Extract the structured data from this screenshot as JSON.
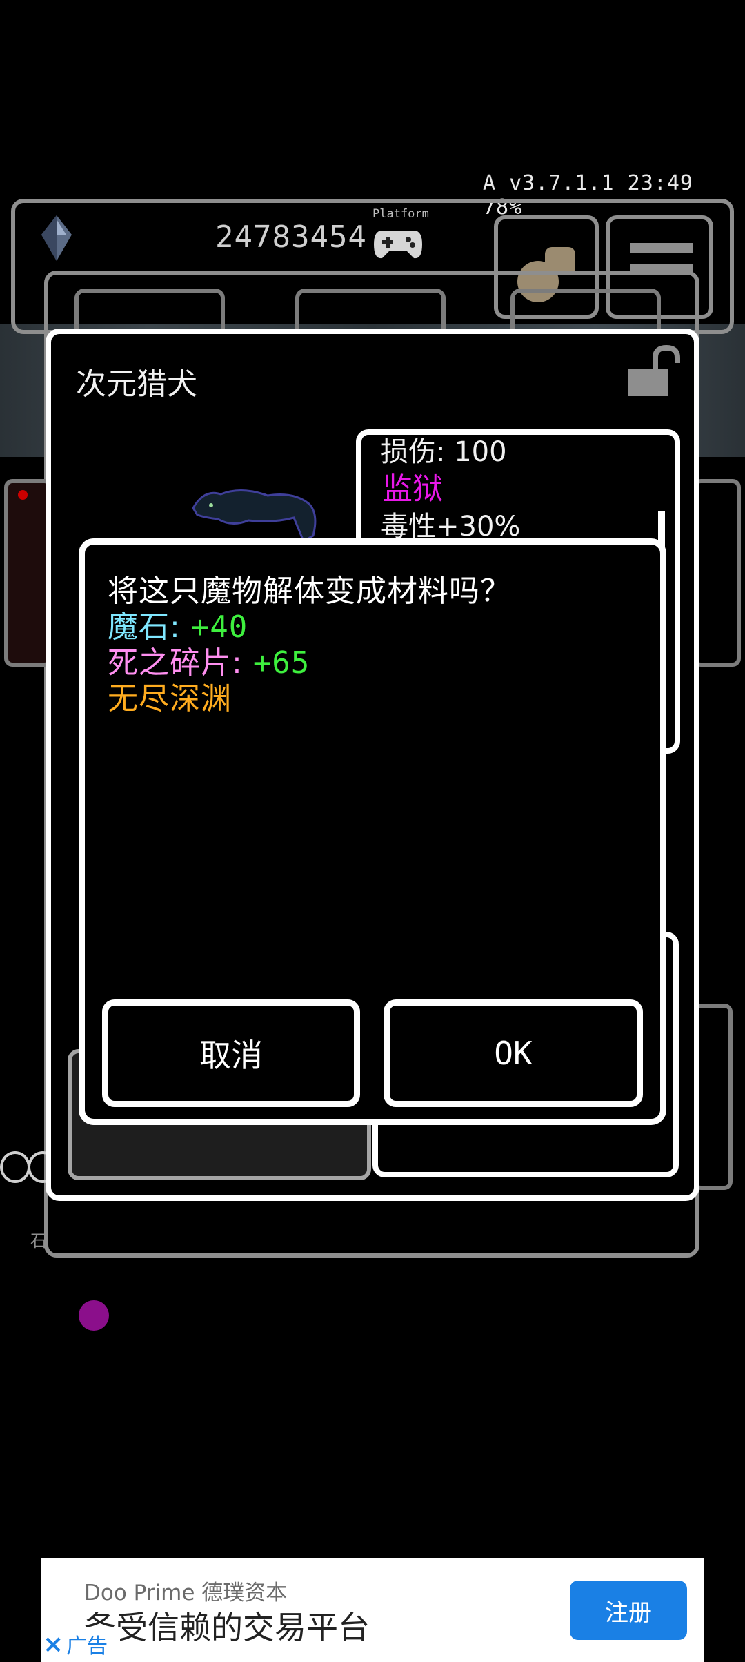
{
  "status_bar": {
    "text": "A v3.7.1.1 23:49 78%"
  },
  "hud": {
    "currency_icon": "crystal-icon",
    "currency_value": "24783454",
    "platform_label": "Platform",
    "platform_icon": "gamepad-icon",
    "chat_icon": "chat-bubbles-icon",
    "menu_icon": "hamburger-menu-icon"
  },
  "monster_panel": {
    "name": "次元猎犬",
    "lock_icon": "unlock-icon",
    "info": {
      "line1": "损伤: 100",
      "line2": "监狱",
      "line3": "毒性+30%"
    },
    "side_label": "石"
  },
  "dialog": {
    "question": "将这只魔物解体变成材料吗？",
    "rewards": [
      {
        "label": "魔石: ",
        "value": "+40",
        "label_color": "#7fe7ff"
      },
      {
        "label": "死之碎片: ",
        "value": "+65",
        "label_color": "#ff8ff0"
      }
    ],
    "location": "无尽深渊",
    "cancel_label": "取消",
    "ok_label": "OK"
  },
  "ad": {
    "brand": "Doo Prime 德璞资本",
    "headline": "备受信赖的交易平台",
    "cta": "注册",
    "close_icon": "×",
    "close_label": "广告",
    "accent": "#1a80e5"
  }
}
